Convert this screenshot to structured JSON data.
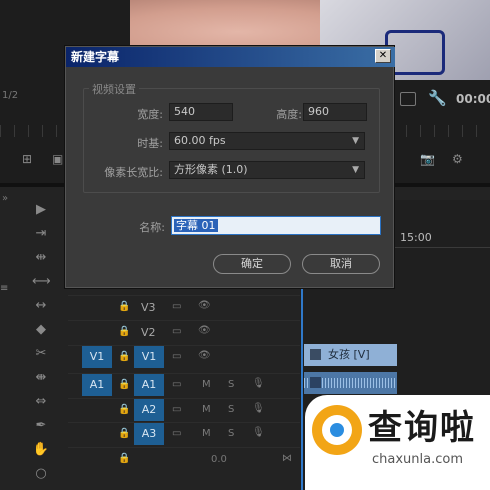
{
  "dialog": {
    "title": "新建字幕",
    "close": "✕",
    "group_title": "视频设置",
    "width_label": "宽度:",
    "width_value": "540",
    "height_label": "高度:",
    "height_value": "960",
    "timebase_label": "时基:",
    "timebase_value": "60.00 fps",
    "par_label": "像素长宽比:",
    "par_value": "方形像素 (1.0)",
    "name_label": "名称:",
    "name_value": "字幕 01",
    "ok_label": "确定",
    "cancel_label": "取消"
  },
  "background": {
    "frame_fraction": "1/2",
    "timecode_right": "00:00",
    "ruler_time": "15:00"
  },
  "tracks": [
    {
      "src": "",
      "label": "V3"
    },
    {
      "src": "",
      "label": "V2"
    },
    {
      "src": "V1",
      "label": "V1"
    },
    {
      "src": "A1",
      "label": "A1"
    },
    {
      "src": "",
      "label": "A2"
    },
    {
      "src": "",
      "label": "A3"
    }
  ],
  "track_ms": {
    "m": "M",
    "s": "S"
  },
  "master_value": "0.0",
  "clips": {
    "video_label": "女孩 [V]"
  },
  "watermark": {
    "text": "查询啦",
    "url": "chaxunla.com"
  }
}
